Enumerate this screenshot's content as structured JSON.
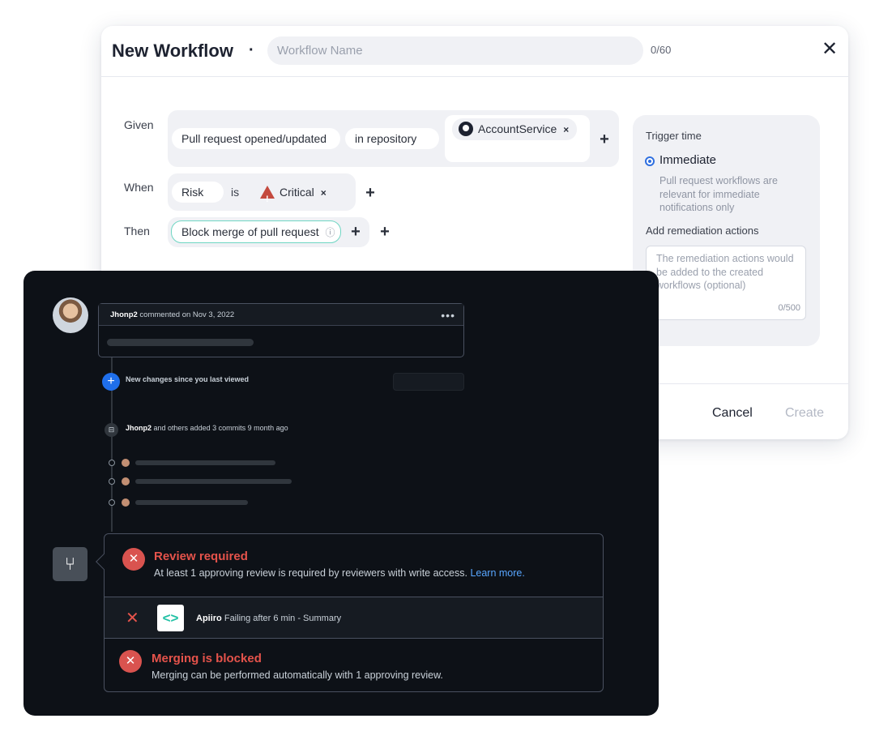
{
  "workflow": {
    "title": "New Workflow",
    "title_dot": "·",
    "name_placeholder": "Workflow Name",
    "name_counter": "0/60",
    "close_glyph": "✕",
    "given_label": "Given",
    "given_chip_event": "Pull request opened/updated",
    "given_chip_scope": "in repository",
    "given_chip_repo": "AccountService",
    "when_label": "When",
    "when_chip_field": "Risk",
    "when_operator": "is",
    "when_chip_value": "Critical",
    "then_label": "Then",
    "then_chip_action": "Block merge of pull request",
    "info_glyph": "ⓘ",
    "remove_glyph": "×",
    "add_glyph": "+",
    "trigger_label": "Trigger time",
    "trigger_option": "Immediate",
    "trigger_desc": "Pull request workflows are relevant for immediate notifications only",
    "remediation_label": "Add remediation actions",
    "remediation_placeholder": "The remediation actions would be added to the created workflows (optional)",
    "remediation_counter": "0/500",
    "cancel_label": "Cancel",
    "create_label": "Create",
    "accent_color": "#2f6fe0",
    "critical_color": "#c44a3e"
  },
  "github": {
    "comment_user": "Jhonp2",
    "comment_meta": "commented on Nov 3, 2022",
    "more_glyph": "•••",
    "new_changes": "New changes since you last viewed",
    "commits_user": "Jhonp2",
    "commits_meta": "and others added 3 commits 9 month ago",
    "review_title": "Review required",
    "review_desc": "At least 1 approving review is required by reviewers with write access.",
    "learn_more": "Learn more.",
    "check_name": "Apiiro",
    "check_status": "Failing after 6 min - Summary",
    "blocked_title": "Merging is blocked",
    "blocked_desc": "Merging can be performed automatically with 1 approving review.",
    "error_color": "#e5534b",
    "link_color": "#58a6ff"
  }
}
